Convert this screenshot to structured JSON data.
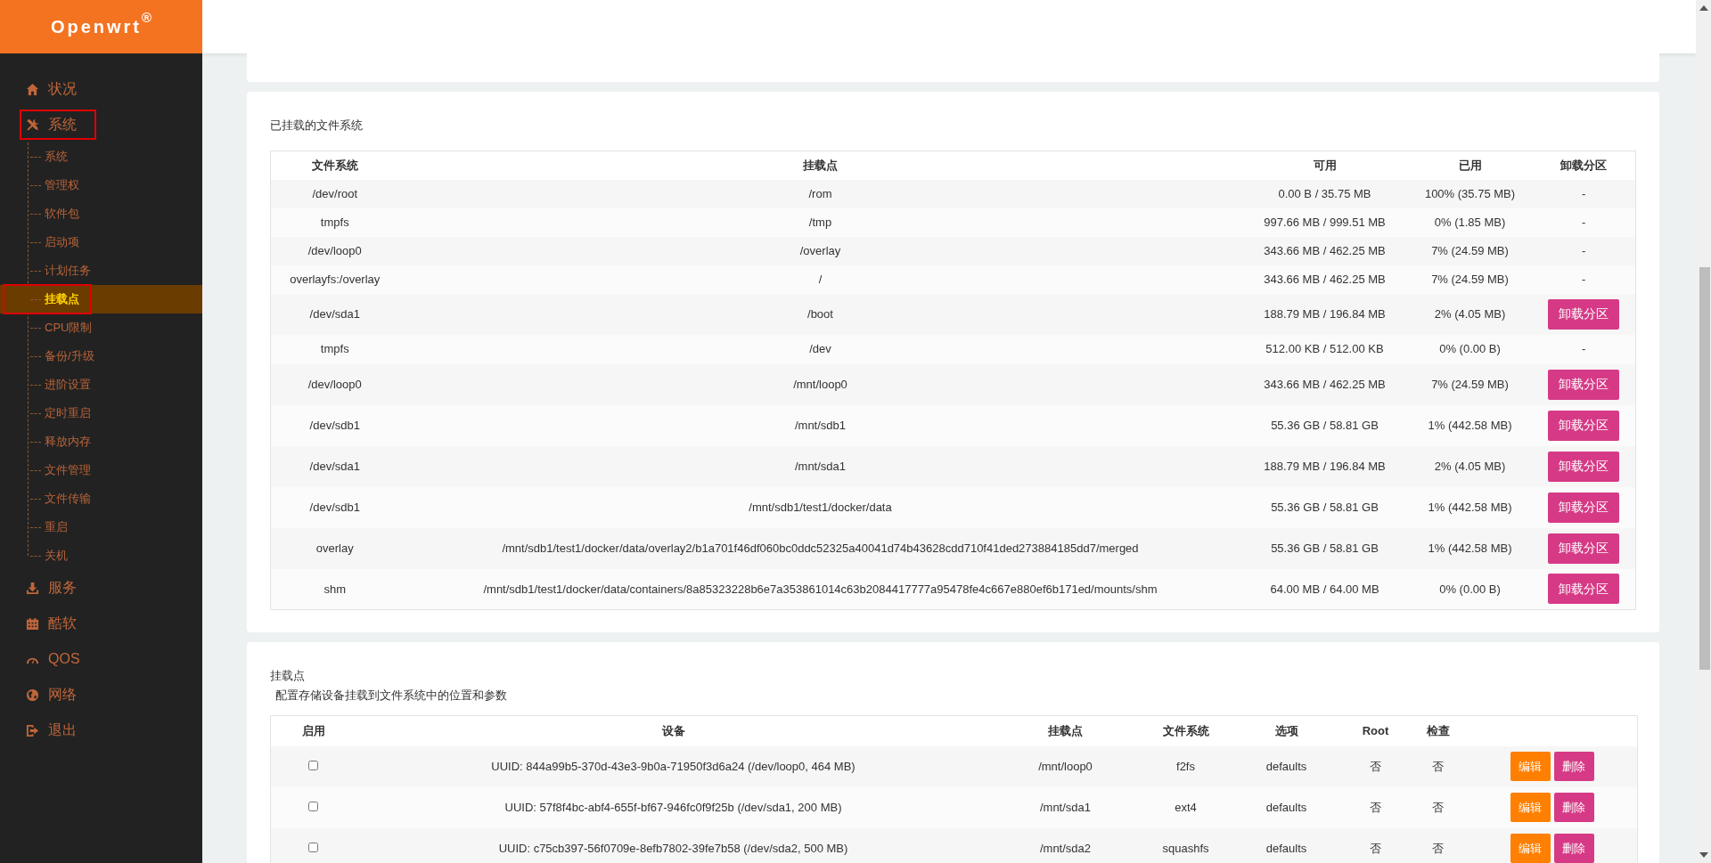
{
  "brand": "Openwrt$^{®}$",
  "sidebar": {
    "items": [
      {
        "kind": "home",
        "label": "状况",
        "annotated": false
      },
      {
        "kind": "tools",
        "label": "系统",
        "annotated": true,
        "children": [
          {
            "label": "系统",
            "selected": false,
            "annotated": false
          },
          {
            "label": "管理权",
            "selected": false,
            "annotated": false
          },
          {
            "label": "软件包",
            "selected": false,
            "annotated": false
          },
          {
            "label": "启动项",
            "selected": false,
            "annotated": false
          },
          {
            "label": "计划任务",
            "selected": false,
            "annotated": false
          },
          {
            "label": "挂载点",
            "selected": true,
            "annotated": true
          },
          {
            "label": "CPU限制",
            "selected": false,
            "annotated": false
          },
          {
            "label": "备份/升级",
            "selected": false,
            "annotated": false
          },
          {
            "label": "进阶设置",
            "selected": false,
            "annotated": false
          },
          {
            "label": "定时重启",
            "selected": false,
            "annotated": false
          },
          {
            "label": "释放内存",
            "selected": false,
            "annotated": false
          },
          {
            "label": "文件管理",
            "selected": false,
            "annotated": false
          },
          {
            "label": "文件传输",
            "selected": false,
            "annotated": false
          },
          {
            "label": "重启",
            "selected": false,
            "annotated": false
          },
          {
            "label": "关机",
            "selected": false,
            "annotated": false
          }
        ]
      },
      {
        "kind": "download",
        "label": "服务",
        "annotated": false
      },
      {
        "kind": "calendar",
        "label": "酷软",
        "annotated": false
      },
      {
        "kind": "gauge",
        "label": "QOS",
        "annotated": false
      },
      {
        "kind": "globe",
        "label": "网络",
        "annotated": false
      },
      {
        "kind": "logout",
        "label": "退出",
        "annotated": false
      }
    ]
  },
  "mounted_filesystems": {
    "title": "已挂载的文件系统",
    "columns": [
      "文件系统",
      "挂载点",
      "可用",
      "已用",
      "卸载分区"
    ],
    "rows": [
      {
        "filesystem": "/dev/root",
        "mount_point": "/rom",
        "available": "0.00 B / 35.75 MB",
        "used": "100% (35.75 MB)",
        "unmount": {
          "kind": "text",
          "label": "-"
        }
      },
      {
        "filesystem": "tmpfs",
        "mount_point": "/tmp",
        "available": "997.66 MB / 999.51 MB",
        "used": "0% (1.85 MB)",
        "unmount": {
          "kind": "text",
          "label": "-"
        }
      },
      {
        "filesystem": "/dev/loop0",
        "mount_point": "/overlay",
        "available": "343.66 MB / 462.25 MB",
        "used": "7% (24.59 MB)",
        "unmount": {
          "kind": "text",
          "label": "-"
        }
      },
      {
        "filesystem": "overlayfs:/overlay",
        "mount_point": "/",
        "available": "343.66 MB / 462.25 MB",
        "used": "7% (24.59 MB)",
        "unmount": {
          "kind": "text",
          "label": "-"
        }
      },
      {
        "filesystem": "/dev/sda1",
        "mount_point": "/boot",
        "available": "188.79 MB / 196.84 MB",
        "used": "2% (4.05 MB)",
        "unmount": {
          "kind": "button",
          "label": "卸载分区"
        }
      },
      {
        "filesystem": "tmpfs",
        "mount_point": "/dev",
        "available": "512.00 KB / 512.00 KB",
        "used": "0% (0.00 B)",
        "unmount": {
          "kind": "text",
          "label": "-"
        }
      },
      {
        "filesystem": "/dev/loop0",
        "mount_point": "/mnt/loop0",
        "available": "343.66 MB / 462.25 MB",
        "used": "7% (24.59 MB)",
        "unmount": {
          "kind": "button",
          "label": "卸载分区"
        }
      },
      {
        "filesystem": "/dev/sdb1",
        "mount_point": "/mnt/sdb1",
        "available": "55.36 GB / 58.81 GB",
        "used": "1% (442.58 MB)",
        "unmount": {
          "kind": "button",
          "label": "卸载分区"
        }
      },
      {
        "filesystem": "/dev/sda1",
        "mount_point": "/mnt/sda1",
        "available": "188.79 MB / 196.84 MB",
        "used": "2% (4.05 MB)",
        "unmount": {
          "kind": "button",
          "label": "卸载分区"
        }
      },
      {
        "filesystem": "/dev/sdb1",
        "mount_point": "/mnt/sdb1/test1/docker/data",
        "available": "55.36 GB / 58.81 GB",
        "used": "1% (442.58 MB)",
        "unmount": {
          "kind": "button",
          "label": "卸载分区"
        }
      },
      {
        "filesystem": "overlay",
        "mount_point": "/mnt/sdb1/test1/docker/data/overlay2/b1a701f46df060bc0ddc52325a40041d74b43628cdd710f41ded273884185dd7/merged",
        "available": "55.36 GB / 58.81 GB",
        "used": "1% (442.58 MB)",
        "unmount": {
          "kind": "button",
          "label": "卸载分区"
        }
      },
      {
        "filesystem": "shm",
        "mount_point": "/mnt/sdb1/test1/docker/data/containers/8a85323228b6e7a353861014c63b2084417777a95478fe4c667e880ef6b171ed/mounts/shm",
        "available": "64.00 MB / 64.00 MB",
        "used": "0% (0.00 B)",
        "unmount": {
          "kind": "button",
          "label": "卸载分区"
        }
      }
    ]
  },
  "mount_points": {
    "title": "挂载点",
    "description": "配置存储设备挂载到文件系统中的位置和参数",
    "columns": [
      "启用",
      "设备",
      "挂载点",
      "文件系统",
      "选项",
      "Root",
      "检查"
    ],
    "rows": [
      {
        "enabled": false,
        "device": "UUID: 844a99b5-370d-43e3-9b0a-71950f3d6a24 (/dev/loop0, 464 MB)",
        "mount_point": "/mnt/loop0",
        "filesystem": "f2fs",
        "options": "defaults",
        "root": "否",
        "check": "否",
        "edit": "编辑",
        "delete": "删除"
      },
      {
        "enabled": false,
        "device": "UUID: 57f8f4bc-abf4-655f-bf67-946fc0f9f25b (/dev/sda1, 200 MB)",
        "mount_point": "/mnt/sda1",
        "filesystem": "ext4",
        "options": "defaults",
        "root": "否",
        "check": "否",
        "edit": "编辑",
        "delete": "删除"
      },
      {
        "enabled": false,
        "device": "UUID: c75cb397-56f0709e-8efb7802-39fe7b58 (/dev/sda2, 500 MB)",
        "mount_point": "/mnt/sda2",
        "filesystem": "squashfs",
        "options": "defaults",
        "root": "否",
        "check": "否",
        "edit": "编辑",
        "delete": "删除"
      }
    ]
  }
}
